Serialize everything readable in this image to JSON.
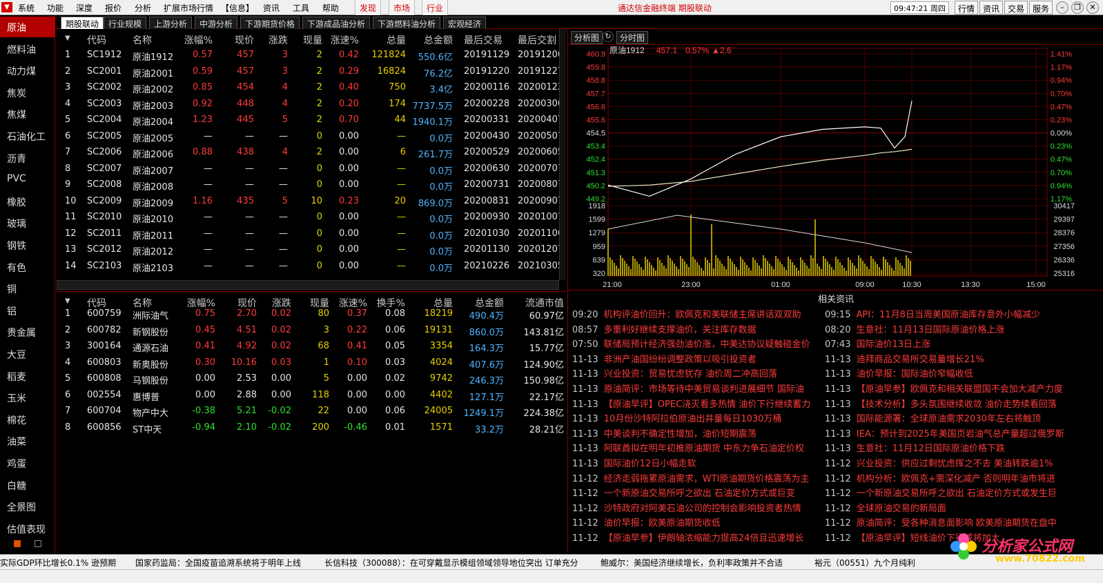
{
  "menu": {
    "items": [
      "系统",
      "功能",
      "深度",
      "报价",
      "分析",
      "扩展市场行情",
      "【信息】",
      "资讯",
      "工具",
      "帮助"
    ],
    "highlights": [
      "发现",
      "市场",
      "行业"
    ],
    "title": "通达信金融终端 期股联动",
    "clock": "09:47:21 周四",
    "right_buttons": [
      "行情",
      "资讯",
      "交易",
      "服务"
    ]
  },
  "sidebar": {
    "items": [
      "原油",
      "燃料油",
      "动力煤",
      "焦炭",
      "焦煤",
      "石油化工",
      "沥青",
      "PVC",
      "橡胶",
      "玻璃",
      "钢铁",
      "有色",
      "铜",
      "铝",
      "贵金属",
      "大豆",
      "稻麦",
      "玉米",
      "棉花",
      "油菜",
      "鸡蛋",
      "白糖",
      "全景图",
      "估值表现"
    ]
  },
  "tabs": {
    "items": [
      "期股联动",
      "行业规模",
      "上游分析",
      "中游分析",
      "下游期货价格",
      "下游成品油分析",
      "下游燃料油分析",
      "宏观经济"
    ],
    "close": "关闭"
  },
  "futures": {
    "headers": [
      "代码",
      "名称",
      "涨幅%",
      "现价",
      "涨跌",
      "现量",
      "涨速%",
      "总量",
      "总金额",
      "最后交易",
      "最后交割"
    ],
    "rows": [
      [
        "1",
        "SC1912",
        "原油1912",
        "0.57",
        "457",
        "3",
        "2",
        "0.42",
        "121824",
        "550.6亿",
        "20191129",
        "20191206"
      ],
      [
        "2",
        "SC2001",
        "原油2001",
        "0.59",
        "457",
        "3",
        "2",
        "0.29",
        "16824",
        "76.2亿",
        "20191220",
        "20191227"
      ],
      [
        "3",
        "SC2002",
        "原油2002",
        "0.85",
        "454",
        "4",
        "2",
        "0.40",
        "750",
        "3.4亿",
        "20200116",
        "20200123"
      ],
      [
        "4",
        "SC2003",
        "原油2003",
        "0.92",
        "448",
        "4",
        "2",
        "0.20",
        "174",
        "7737.5万",
        "20200228",
        "20200306"
      ],
      [
        "5",
        "SC2004",
        "原油2004",
        "1.23",
        "445",
        "5",
        "2",
        "0.70",
        "44",
        "1940.1万",
        "20200331",
        "20200407"
      ],
      [
        "6",
        "SC2005",
        "原油2005",
        "—",
        "—",
        "—",
        "0",
        "0.00",
        "—",
        "0.0万",
        "20200430",
        "20200507"
      ],
      [
        "7",
        "SC2006",
        "原油2006",
        "0.88",
        "438",
        "4",
        "2",
        "0.00",
        "6",
        "261.7万",
        "20200529",
        "20200605"
      ],
      [
        "8",
        "SC2007",
        "原油2007",
        "—",
        "—",
        "—",
        "0",
        "0.00",
        "—",
        "0.0万",
        "20200630",
        "20200707"
      ],
      [
        "9",
        "SC2008",
        "原油2008",
        "—",
        "—",
        "—",
        "0",
        "0.00",
        "—",
        "0.0万",
        "20200731",
        "20200807"
      ],
      [
        "10",
        "SC2009",
        "原油2009",
        "1.16",
        "435",
        "5",
        "10",
        "0.23",
        "20",
        "869.0万",
        "20200831",
        "20200907"
      ],
      [
        "11",
        "SC2010",
        "原油2010",
        "—",
        "—",
        "—",
        "0",
        "0.00",
        "—",
        "0.0万",
        "20200930",
        "20201007"
      ],
      [
        "12",
        "SC2011",
        "原油2011",
        "—",
        "—",
        "—",
        "0",
        "0.00",
        "—",
        "0.0万",
        "20201030",
        "20201106"
      ],
      [
        "13",
        "SC2012",
        "原油2012",
        "—",
        "—",
        "—",
        "0",
        "0.00",
        "—",
        "0.0万",
        "20201130",
        "20201207"
      ],
      [
        "14",
        "SC2103",
        "原油2103",
        "—",
        "—",
        "—",
        "0",
        "0.00",
        "—",
        "0.0万",
        "20210226",
        "20210305"
      ]
    ]
  },
  "stocks": {
    "headers": [
      "代码",
      "名称",
      "涨幅%",
      "现价",
      "涨跌",
      "现量",
      "涨速%",
      "换手%",
      "总量",
      "总金额",
      "流通市值"
    ],
    "rows": [
      [
        "1",
        "600759",
        "洲际油气",
        "0.75",
        "2.70",
        "0.02",
        "80",
        "0.37",
        "0.08",
        "18219",
        "490.4万",
        "60.97亿"
      ],
      [
        "2",
        "600782",
        "新钢股份",
        "0.45",
        "4.51",
        "0.02",
        "3",
        "0.22",
        "0.06",
        "19131",
        "860.0万",
        "143.81亿"
      ],
      [
        "3",
        "300164",
        "通源石油",
        "0.41",
        "4.92",
        "0.02",
        "68",
        "0.41",
        "0.05",
        "3354",
        "164.3万",
        "15.77亿"
      ],
      [
        "4",
        "600803",
        "新奥股份",
        "0.30",
        "10.16",
        "0.03",
        "1",
        "0.10",
        "0.03",
        "4024",
        "407.6万",
        "124.90亿"
      ],
      [
        "5",
        "600808",
        "马钢股份",
        "0.00",
        "2.53",
        "0.00",
        "5",
        "0.00",
        "0.02",
        "9742",
        "246.3万",
        "150.98亿"
      ],
      [
        "6",
        "002554",
        "惠博普",
        "0.00",
        "2.88",
        "0.00",
        "118",
        "0.00",
        "0.00",
        "4402",
        "127.1万",
        "22.17亿"
      ],
      [
        "7",
        "600704",
        "物产中大",
        "-0.38",
        "5.21",
        "-0.02",
        "22",
        "0.00",
        "0.06",
        "24005",
        "1249.1万",
        "224.38亿"
      ],
      [
        "8",
        "600856",
        "ST中天",
        "-0.94",
        "2.10",
        "-0.02",
        "200",
        "-0.46",
        "0.01",
        "1571",
        "33.2万",
        "28.21亿"
      ]
    ]
  },
  "chart": {
    "tabs": [
      "分析图",
      "分时图"
    ],
    "symbol": "原油1912",
    "price": "457.1",
    "pct": "0.57%",
    "chg": "▲2.6",
    "price_ticks": [
      "460.9",
      "459.8",
      "458.8",
      "457.7",
      "456.6",
      "455.6",
      "454.5",
      "453.4",
      "452.4",
      "451.3",
      "450.2",
      "449.2"
    ],
    "pct_ticks": [
      "1.41%",
      "1.17%",
      "0.94%",
      "0.70%",
      "0.47%",
      "0.23%",
      "0.00%",
      "0.23%",
      "0.47%",
      "0.70%",
      "0.94%",
      "1.17%"
    ],
    "vol_ticks": [
      "1918",
      "1599",
      "1279",
      "959",
      "639",
      "320"
    ],
    "oi_ticks": [
      "30417",
      "29397",
      "28376",
      "27356",
      "26336",
      "25316"
    ],
    "time_ticks": [
      "21:00",
      "23:00",
      "01:00",
      "09:00",
      "10:30",
      "13:30",
      "15:00"
    ],
    "colors": {
      "price": "#ffffff",
      "avg": "#e8e8c0",
      "vol": "#e8d000",
      "oi": "#dcdcdc",
      "grid": "#7a0000"
    }
  },
  "chart_data": {
    "type": "line",
    "title": "原油1912",
    "x": [
      "21:00",
      "22:00",
      "23:00",
      "00:00",
      "01:00",
      "02:00",
      "09:00",
      "09:30",
      "10:00",
      "10:15",
      "10:30"
    ],
    "series": [
      {
        "name": "price",
        "values": [
          450.3,
          449.4,
          450.8,
          452.8,
          454.2,
          454.8,
          455.0,
          454.9,
          453.3,
          454.2,
          457.1
        ]
      },
      {
        "name": "avg",
        "values": [
          450.2,
          450.3,
          450.6,
          451.2,
          451.8,
          452.3,
          452.7,
          452.9,
          453.0,
          453.1,
          453.2
        ]
      }
    ],
    "ylim": [
      449.2,
      460.9
    ]
  },
  "news": {
    "title": "相关资讯",
    "left": [
      [
        "09:20",
        "机构评油价回升：欧佩克和美联储主席讲话双双助"
      ],
      [
        "08:57",
        "多重利好继续支撑油价，关注库存数据"
      ],
      [
        "07:50",
        "联储局预计经济强劲油价涨，中美达协议疑触碰金价"
      ],
      [
        "11-13",
        "非洲产油国纷纷调整政策以吸引投资者"
      ],
      [
        "11-13",
        "兴业投资：贸易忧虑犹存 油价周二冲高回落"
      ],
      [
        "11-13",
        "原油简评：市场等待中美贸易谈判进展细节 国际油"
      ],
      [
        "11-13",
        "【原油早评】OPEC浇灭看多热情 油价下行继续蓄力"
      ],
      [
        "11-13",
        "10月份沙特阿拉伯原油出井量每日1030万桶"
      ],
      [
        "11-13",
        "中美谈判不确定性增加，油价短期震荡"
      ],
      [
        "11-13",
        "阿联酋拟在明年初推原油期货 中东力争石油定价权"
      ],
      [
        "11-13",
        "国际油价12日小幅走软"
      ],
      [
        "11-12",
        "经济走弱拖累原油需求，WTI原油期货价格震荡为主"
      ],
      [
        "11-12",
        "一个新原油交易所呼之欲出 石油定价方式或巨变"
      ],
      [
        "11-12",
        "沙特政府对阿美石油公司的控制会影响投资者热情"
      ],
      [
        "11-12",
        "油价早报：欧美原油期货收低"
      ],
      [
        "11-12",
        "【原油早参】伊朗轴浓缩能力提高24倍且迅速增长"
      ]
    ],
    "right": [
      [
        "09:15",
        "API：11月8日当周美国原油库存意外小幅减少"
      ],
      [
        "08:20",
        "生意社：11月13日国际原油价格上涨"
      ],
      [
        "07:43",
        "国际油价13日上涨"
      ],
      [
        "11-13",
        "迪拜商品交易所交易量增长21%"
      ],
      [
        "11-13",
        "油价早报：国际油价窄幅收低"
      ],
      [
        "11-13",
        "【原油早参】欧佩克和相关联盟国不会加大减产力度"
      ],
      [
        "11-13",
        "【技术分析】多头氛围继续收敛 油价走势续看回落"
      ],
      [
        "11-13",
        "国际能源署：全球原油需求2030年左右将触顶"
      ],
      [
        "11-13",
        "IEA：预计到2025年美国页岩油气总产量超过俄罗斯"
      ],
      [
        "11-13",
        "生意社：11月12日国际原油价格下跌"
      ],
      [
        "11-12",
        "兴业投资：供应过剩忧虑挥之不去 美油转跌逾1%"
      ],
      [
        "11-12",
        "机构分析：欧佩克+需深化减产 否则明年油市将进"
      ],
      [
        "11-12",
        "一个新原油交易所呼之欲出 石油定价方式或发生巨"
      ],
      [
        "11-12",
        "全球原油交易的新局面"
      ],
      [
        "11-12",
        "原油简评：受各种消息面影响 欧美原油期货在盘中"
      ],
      [
        "11-12",
        "【原油早评】短线油价下行或将加大"
      ]
    ]
  },
  "ticker": [
    "实际GDP环比增长0.1% 逊预期",
    "国家药监局：全国疫苗追溯系统将于明年上线",
    "长信科技（300088）：在可穿戴显示模组领域领导地位突出 订单充分",
    "鲍威尔：美国经济继续增长，负利率政策并不合适",
    "裕元（00551）九个月纯利"
  ],
  "watermark": {
    "line1": "分析家公式网",
    "line2": "www.70822.com"
  }
}
